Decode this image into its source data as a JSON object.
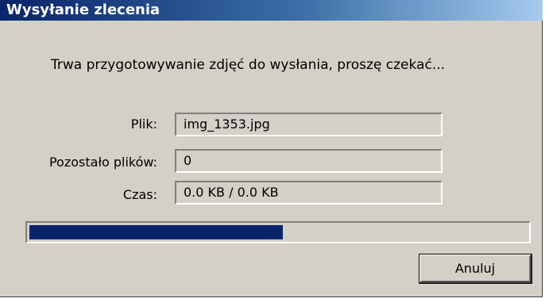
{
  "dialog": {
    "title": "Wysyłanie zlecenia",
    "message": "Trwa przygotowywanie zdjęć do wysłania, proszę czekać..."
  },
  "fields": {
    "file_label": "Plik:",
    "file_value": "img_1353.jpg",
    "remaining_label": "Pozostało plików:",
    "remaining_value": "0",
    "time_label": "Czas:",
    "time_value": "0.0 KB / 0.0 KB"
  },
  "progress": {
    "fraction": 0.51
  },
  "buttons": {
    "cancel_label": "Anuluj"
  },
  "colors": {
    "title_gradient_start": "#0a246a",
    "title_gradient_end": "#a6caf0",
    "progress_fill": "#0a246a",
    "face": "#d4d0c8"
  }
}
